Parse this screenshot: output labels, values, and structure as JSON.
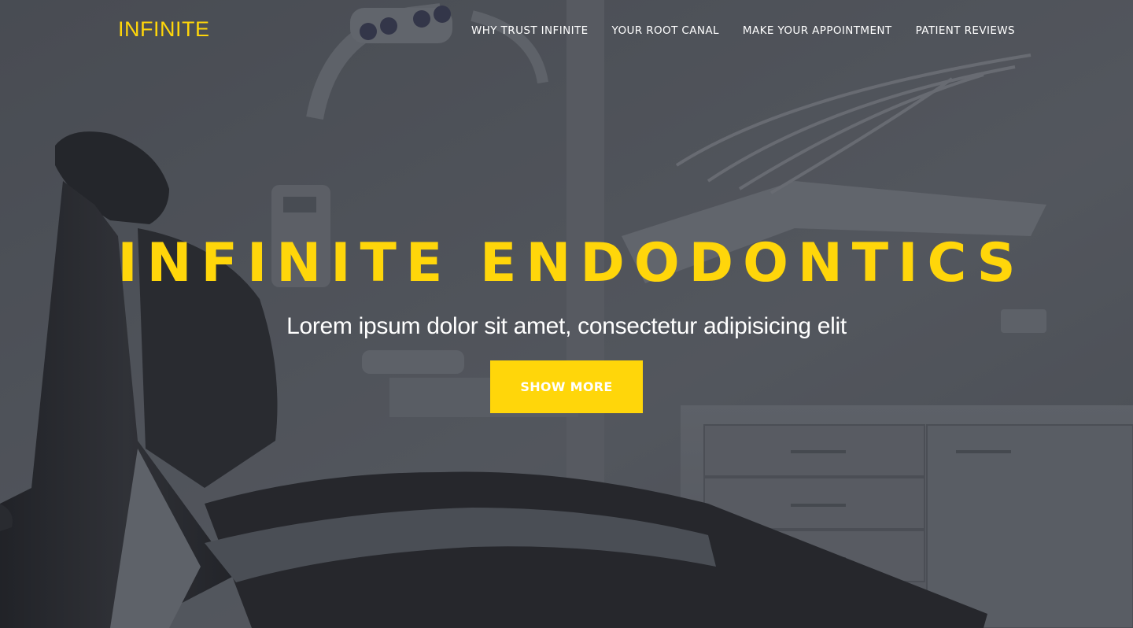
{
  "brand": {
    "name": "INFINITE"
  },
  "nav": {
    "items": [
      {
        "label": "WHY TRUST INFINITE"
      },
      {
        "label": "YOUR ROOT CANAL"
      },
      {
        "label": "MAKE YOUR APPOINTMENT"
      },
      {
        "label": "PATIENT REVIEWS"
      }
    ]
  },
  "hero": {
    "title": "INFINITE ENDODONTICS",
    "subtitle": "Lorem ipsum dolor sit amet, consectetur adipisicing elit",
    "cta_label": "SHOW MORE",
    "background_image": "dental-chair-photo"
  },
  "colors": {
    "accent": "#ffd60a",
    "text_light": "#ffffff",
    "overlay": "#282c34"
  }
}
